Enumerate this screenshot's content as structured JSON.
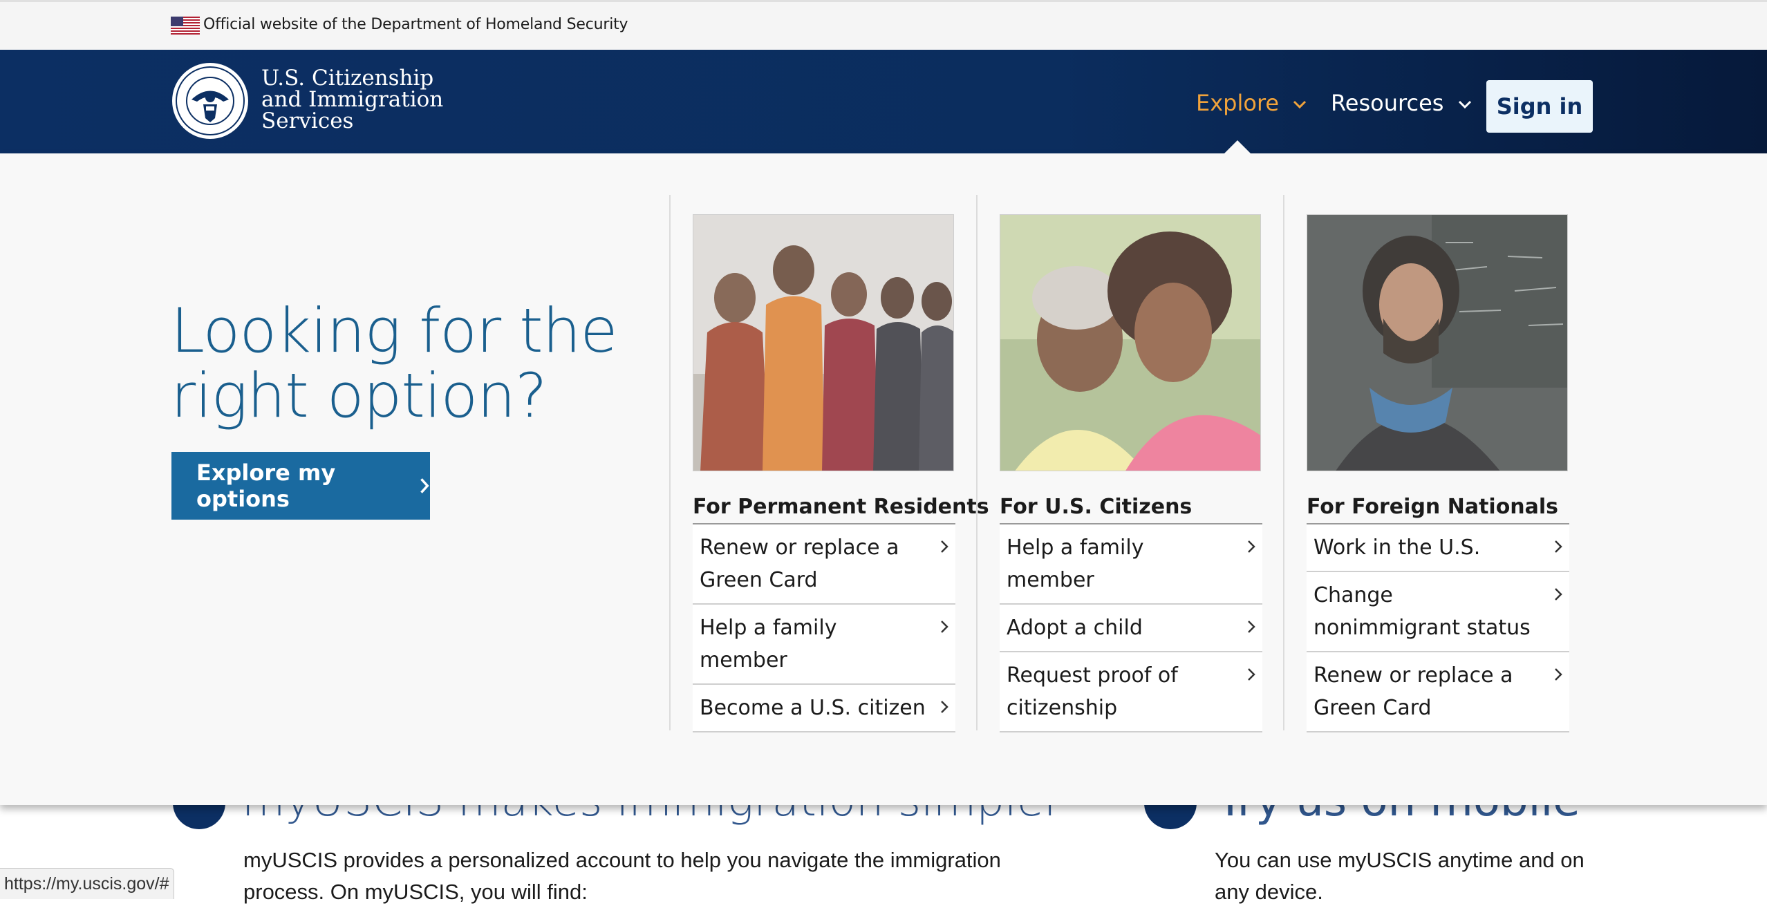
{
  "gov_banner": {
    "text": "Official website of the Department of Homeland Security"
  },
  "header": {
    "brand_lines": [
      "U.S. Citizenship",
      "and Immigration",
      "Services"
    ],
    "nav": {
      "explore": "Explore",
      "resources": "Resources"
    },
    "sign_in": "Sign in",
    "colors": {
      "accent": "#f1a33b",
      "header_bg": "#0c2f63"
    }
  },
  "mega_menu": {
    "hero_title": "Looking for the right option?",
    "explore_button": "Explore my options",
    "columns": [
      {
        "title": "For Permanent Residents",
        "photo": "group-of-women-photo",
        "links": [
          "Renew or replace a Green Card",
          "Help a family member",
          "Become a U.S. citizen"
        ]
      },
      {
        "title": "For U.S. Citizens",
        "photo": "mother-daughter-photo",
        "links": [
          "Help a family member",
          "Adopt a child",
          "Request proof of citizenship"
        ]
      },
      {
        "title": "For Foreign Nationals",
        "photo": "man-at-chalkboard-photo",
        "links": [
          "Work in the U.S.",
          "Change nonimmigrant status",
          "Renew or replace a Green Card"
        ]
      }
    ]
  },
  "underlying": {
    "heading_left": "myUSCIS makes immigration simpler",
    "heading_right": "Try us on mobile",
    "para_left": "myUSCIS provides a personalized account to help you navigate the immigration process. On myUSCIS, you will find:",
    "para_right": "You can use myUSCIS anytime and on any device."
  },
  "status_bar": {
    "url": "https://my.uscis.gov/#"
  }
}
